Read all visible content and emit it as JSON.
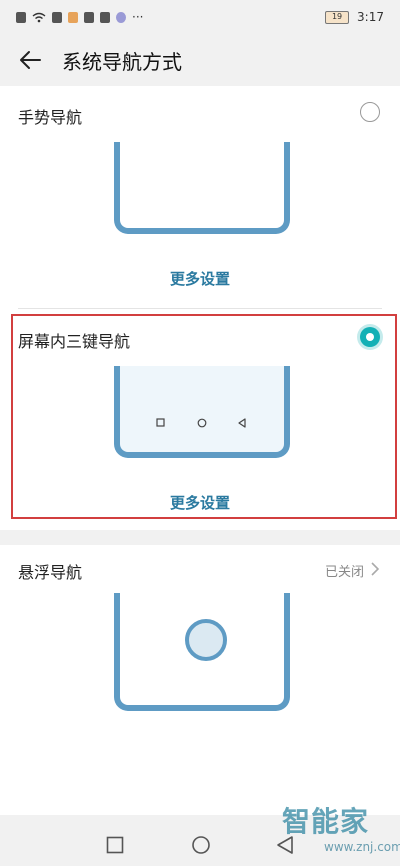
{
  "status_bar": {
    "time": "3:17",
    "battery": "19",
    "more": "···"
  },
  "header": {
    "title": "系统导航方式"
  },
  "options": [
    {
      "label": "手势导航",
      "more": "更多设置",
      "selected": false
    },
    {
      "label": "屏幕内三键导航",
      "more": "更多设置",
      "selected": true
    },
    {
      "label": "悬浮导航",
      "status": "已关闭"
    }
  ],
  "watermark": {
    "text": "智能家",
    "url": "www.znj.com"
  },
  "colors": {
    "accent": "#13b0b5",
    "illustration": "#5e9bc4",
    "link": "#2b7aa0",
    "highlight": "#d23f3f"
  }
}
